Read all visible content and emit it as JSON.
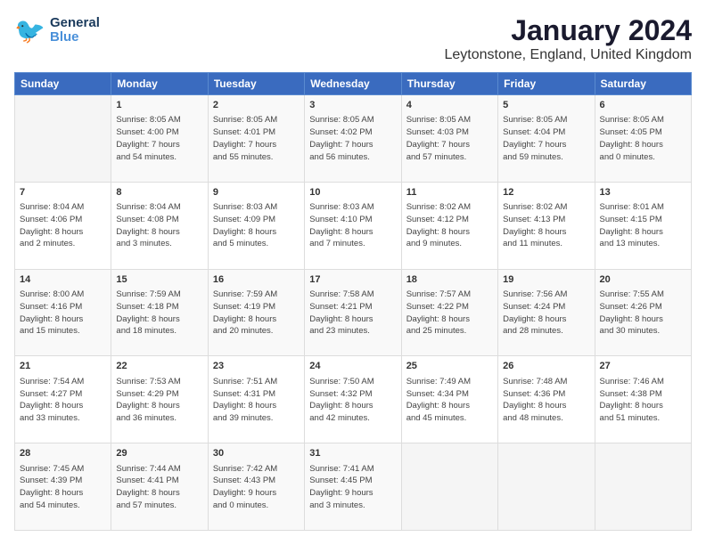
{
  "header": {
    "logo_general": "General",
    "logo_blue": "Blue",
    "title": "January 2024",
    "subtitle": "Leytonstone, England, United Kingdom"
  },
  "calendar": {
    "days": [
      "Sunday",
      "Monday",
      "Tuesday",
      "Wednesday",
      "Thursday",
      "Friday",
      "Saturday"
    ],
    "weeks": [
      [
        {
          "num": "",
          "info": ""
        },
        {
          "num": "1",
          "info": "Sunrise: 8:05 AM\nSunset: 4:00 PM\nDaylight: 7 hours\nand 54 minutes."
        },
        {
          "num": "2",
          "info": "Sunrise: 8:05 AM\nSunset: 4:01 PM\nDaylight: 7 hours\nand 55 minutes."
        },
        {
          "num": "3",
          "info": "Sunrise: 8:05 AM\nSunset: 4:02 PM\nDaylight: 7 hours\nand 56 minutes."
        },
        {
          "num": "4",
          "info": "Sunrise: 8:05 AM\nSunset: 4:03 PM\nDaylight: 7 hours\nand 57 minutes."
        },
        {
          "num": "5",
          "info": "Sunrise: 8:05 AM\nSunset: 4:04 PM\nDaylight: 7 hours\nand 59 minutes."
        },
        {
          "num": "6",
          "info": "Sunrise: 8:05 AM\nSunset: 4:05 PM\nDaylight: 8 hours\nand 0 minutes."
        }
      ],
      [
        {
          "num": "7",
          "info": "Sunrise: 8:04 AM\nSunset: 4:06 PM\nDaylight: 8 hours\nand 2 minutes."
        },
        {
          "num": "8",
          "info": "Sunrise: 8:04 AM\nSunset: 4:08 PM\nDaylight: 8 hours\nand 3 minutes."
        },
        {
          "num": "9",
          "info": "Sunrise: 8:03 AM\nSunset: 4:09 PM\nDaylight: 8 hours\nand 5 minutes."
        },
        {
          "num": "10",
          "info": "Sunrise: 8:03 AM\nSunset: 4:10 PM\nDaylight: 8 hours\nand 7 minutes."
        },
        {
          "num": "11",
          "info": "Sunrise: 8:02 AM\nSunset: 4:12 PM\nDaylight: 8 hours\nand 9 minutes."
        },
        {
          "num": "12",
          "info": "Sunrise: 8:02 AM\nSunset: 4:13 PM\nDaylight: 8 hours\nand 11 minutes."
        },
        {
          "num": "13",
          "info": "Sunrise: 8:01 AM\nSunset: 4:15 PM\nDaylight: 8 hours\nand 13 minutes."
        }
      ],
      [
        {
          "num": "14",
          "info": "Sunrise: 8:00 AM\nSunset: 4:16 PM\nDaylight: 8 hours\nand 15 minutes."
        },
        {
          "num": "15",
          "info": "Sunrise: 7:59 AM\nSunset: 4:18 PM\nDaylight: 8 hours\nand 18 minutes."
        },
        {
          "num": "16",
          "info": "Sunrise: 7:59 AM\nSunset: 4:19 PM\nDaylight: 8 hours\nand 20 minutes."
        },
        {
          "num": "17",
          "info": "Sunrise: 7:58 AM\nSunset: 4:21 PM\nDaylight: 8 hours\nand 23 minutes."
        },
        {
          "num": "18",
          "info": "Sunrise: 7:57 AM\nSunset: 4:22 PM\nDaylight: 8 hours\nand 25 minutes."
        },
        {
          "num": "19",
          "info": "Sunrise: 7:56 AM\nSunset: 4:24 PM\nDaylight: 8 hours\nand 28 minutes."
        },
        {
          "num": "20",
          "info": "Sunrise: 7:55 AM\nSunset: 4:26 PM\nDaylight: 8 hours\nand 30 minutes."
        }
      ],
      [
        {
          "num": "21",
          "info": "Sunrise: 7:54 AM\nSunset: 4:27 PM\nDaylight: 8 hours\nand 33 minutes."
        },
        {
          "num": "22",
          "info": "Sunrise: 7:53 AM\nSunset: 4:29 PM\nDaylight: 8 hours\nand 36 minutes."
        },
        {
          "num": "23",
          "info": "Sunrise: 7:51 AM\nSunset: 4:31 PM\nDaylight: 8 hours\nand 39 minutes."
        },
        {
          "num": "24",
          "info": "Sunrise: 7:50 AM\nSunset: 4:32 PM\nDaylight: 8 hours\nand 42 minutes."
        },
        {
          "num": "25",
          "info": "Sunrise: 7:49 AM\nSunset: 4:34 PM\nDaylight: 8 hours\nand 45 minutes."
        },
        {
          "num": "26",
          "info": "Sunrise: 7:48 AM\nSunset: 4:36 PM\nDaylight: 8 hours\nand 48 minutes."
        },
        {
          "num": "27",
          "info": "Sunrise: 7:46 AM\nSunset: 4:38 PM\nDaylight: 8 hours\nand 51 minutes."
        }
      ],
      [
        {
          "num": "28",
          "info": "Sunrise: 7:45 AM\nSunset: 4:39 PM\nDaylight: 8 hours\nand 54 minutes."
        },
        {
          "num": "29",
          "info": "Sunrise: 7:44 AM\nSunset: 4:41 PM\nDaylight: 8 hours\nand 57 minutes."
        },
        {
          "num": "30",
          "info": "Sunrise: 7:42 AM\nSunset: 4:43 PM\nDaylight: 9 hours\nand 0 minutes."
        },
        {
          "num": "31",
          "info": "Sunrise: 7:41 AM\nSunset: 4:45 PM\nDaylight: 9 hours\nand 3 minutes."
        },
        {
          "num": "",
          "info": ""
        },
        {
          "num": "",
          "info": ""
        },
        {
          "num": "",
          "info": ""
        }
      ]
    ]
  }
}
